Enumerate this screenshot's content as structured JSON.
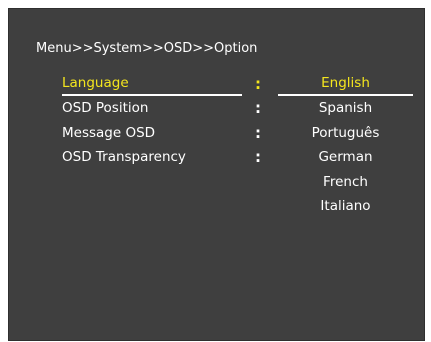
{
  "breadcrumb": "Menu>>System>>OSD>>Option",
  "settings": [
    {
      "label": "Language",
      "selected": true
    },
    {
      "label": "OSD Position",
      "selected": false
    },
    {
      "label": "Message OSD",
      "selected": false
    },
    {
      "label": "OSD Transparency",
      "selected": false
    }
  ],
  "separator": ":",
  "language_options": [
    {
      "label": "English",
      "selected": true
    },
    {
      "label": "Spanish",
      "selected": false
    },
    {
      "label": "Português",
      "selected": false
    },
    {
      "label": "German",
      "selected": false
    },
    {
      "label": "French",
      "selected": false
    },
    {
      "label": "Italiano",
      "selected": false
    }
  ],
  "colors": {
    "background": "#3f3f3f",
    "highlight": "#f4e61e",
    "text": "#ffffff"
  }
}
